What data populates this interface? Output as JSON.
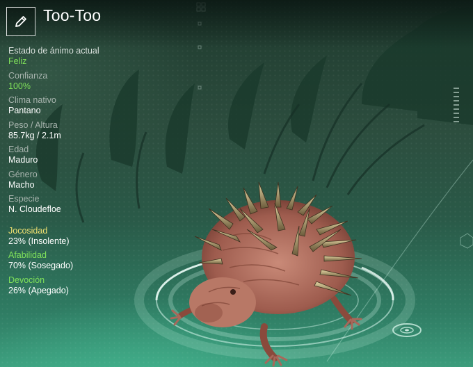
{
  "creature": {
    "name": "Too-Too"
  },
  "stats": [
    {
      "label": "Estado de ánimo actual",
      "value": "Feliz",
      "value_color": "green",
      "label_style": "primary"
    },
    {
      "label": "Confianza",
      "value": "100%",
      "value_color": "green"
    },
    {
      "label": "Clima nativo",
      "value": "Pantano"
    },
    {
      "label": "Peso / Altura",
      "value": "85.7kg / 2.1m"
    },
    {
      "label": "Edad",
      "value": "Maduro"
    },
    {
      "label": "Género",
      "value": "Macho"
    },
    {
      "label": "Especie",
      "value": "N. Cloudefloe"
    }
  ],
  "traits": [
    {
      "label": "Jocosidad",
      "value": "23% (Insolente)",
      "label_color": "yellow"
    },
    {
      "label": "Afabilidad",
      "value": "70% (Sosegado)",
      "label_color": "green"
    },
    {
      "label": "Devoción",
      "value": "26% (Apegado)",
      "label_color": "green"
    }
  ],
  "icons": {
    "edit": "pencil-icon"
  },
  "colors": {
    "positive": "#7fe05a",
    "playfulness": "#f0e070",
    "hud_ring": "#bff3e0"
  }
}
